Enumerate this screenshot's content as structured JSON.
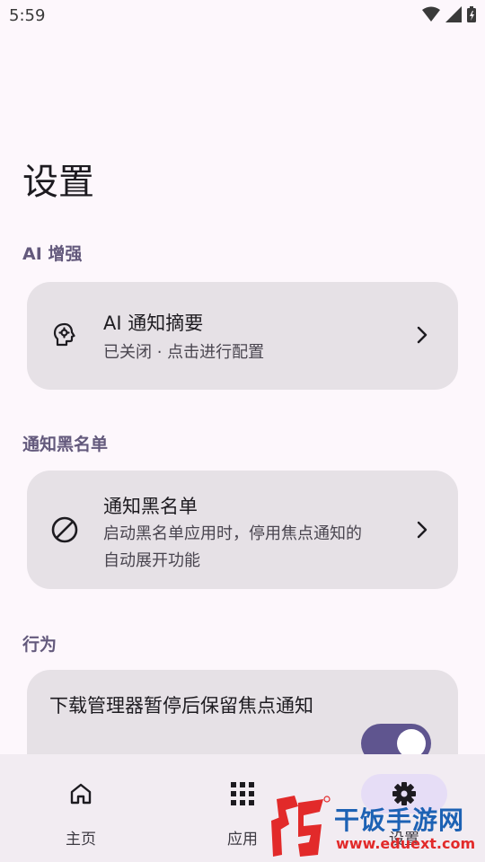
{
  "status_bar": {
    "time": "5:59"
  },
  "page": {
    "title": "设置"
  },
  "sections": {
    "ai": {
      "label": "AI 增强",
      "card": {
        "title": "AI 通知摘要",
        "subtitle": "已关闭 · 点击进行配置",
        "icon": "brain-icon"
      }
    },
    "blacklist": {
      "label": "通知黑名单",
      "card": {
        "title": "通知黑名单",
        "subtitle": "启动黑名单应用时，停用焦点通知的自动展开功能",
        "icon": "block-icon"
      }
    },
    "behavior": {
      "label": "行为",
      "card": {
        "title": "下载管理器暂停后保留焦点通知",
        "toggle_on": true
      }
    }
  },
  "bottom_nav": {
    "items": [
      {
        "label": "主页",
        "icon": "home-icon"
      },
      {
        "label": "应用",
        "icon": "apps-grid-icon"
      },
      {
        "label": "设置",
        "icon": "gear-icon",
        "active": true
      }
    ]
  },
  "watermark": {
    "name": "干饭手游网",
    "url": "www.eduext.com"
  },
  "colors": {
    "accent": "#5f558f",
    "section_label": "#63597c",
    "card_bg": "#e6e1e6",
    "background": "#fdf7fc"
  }
}
